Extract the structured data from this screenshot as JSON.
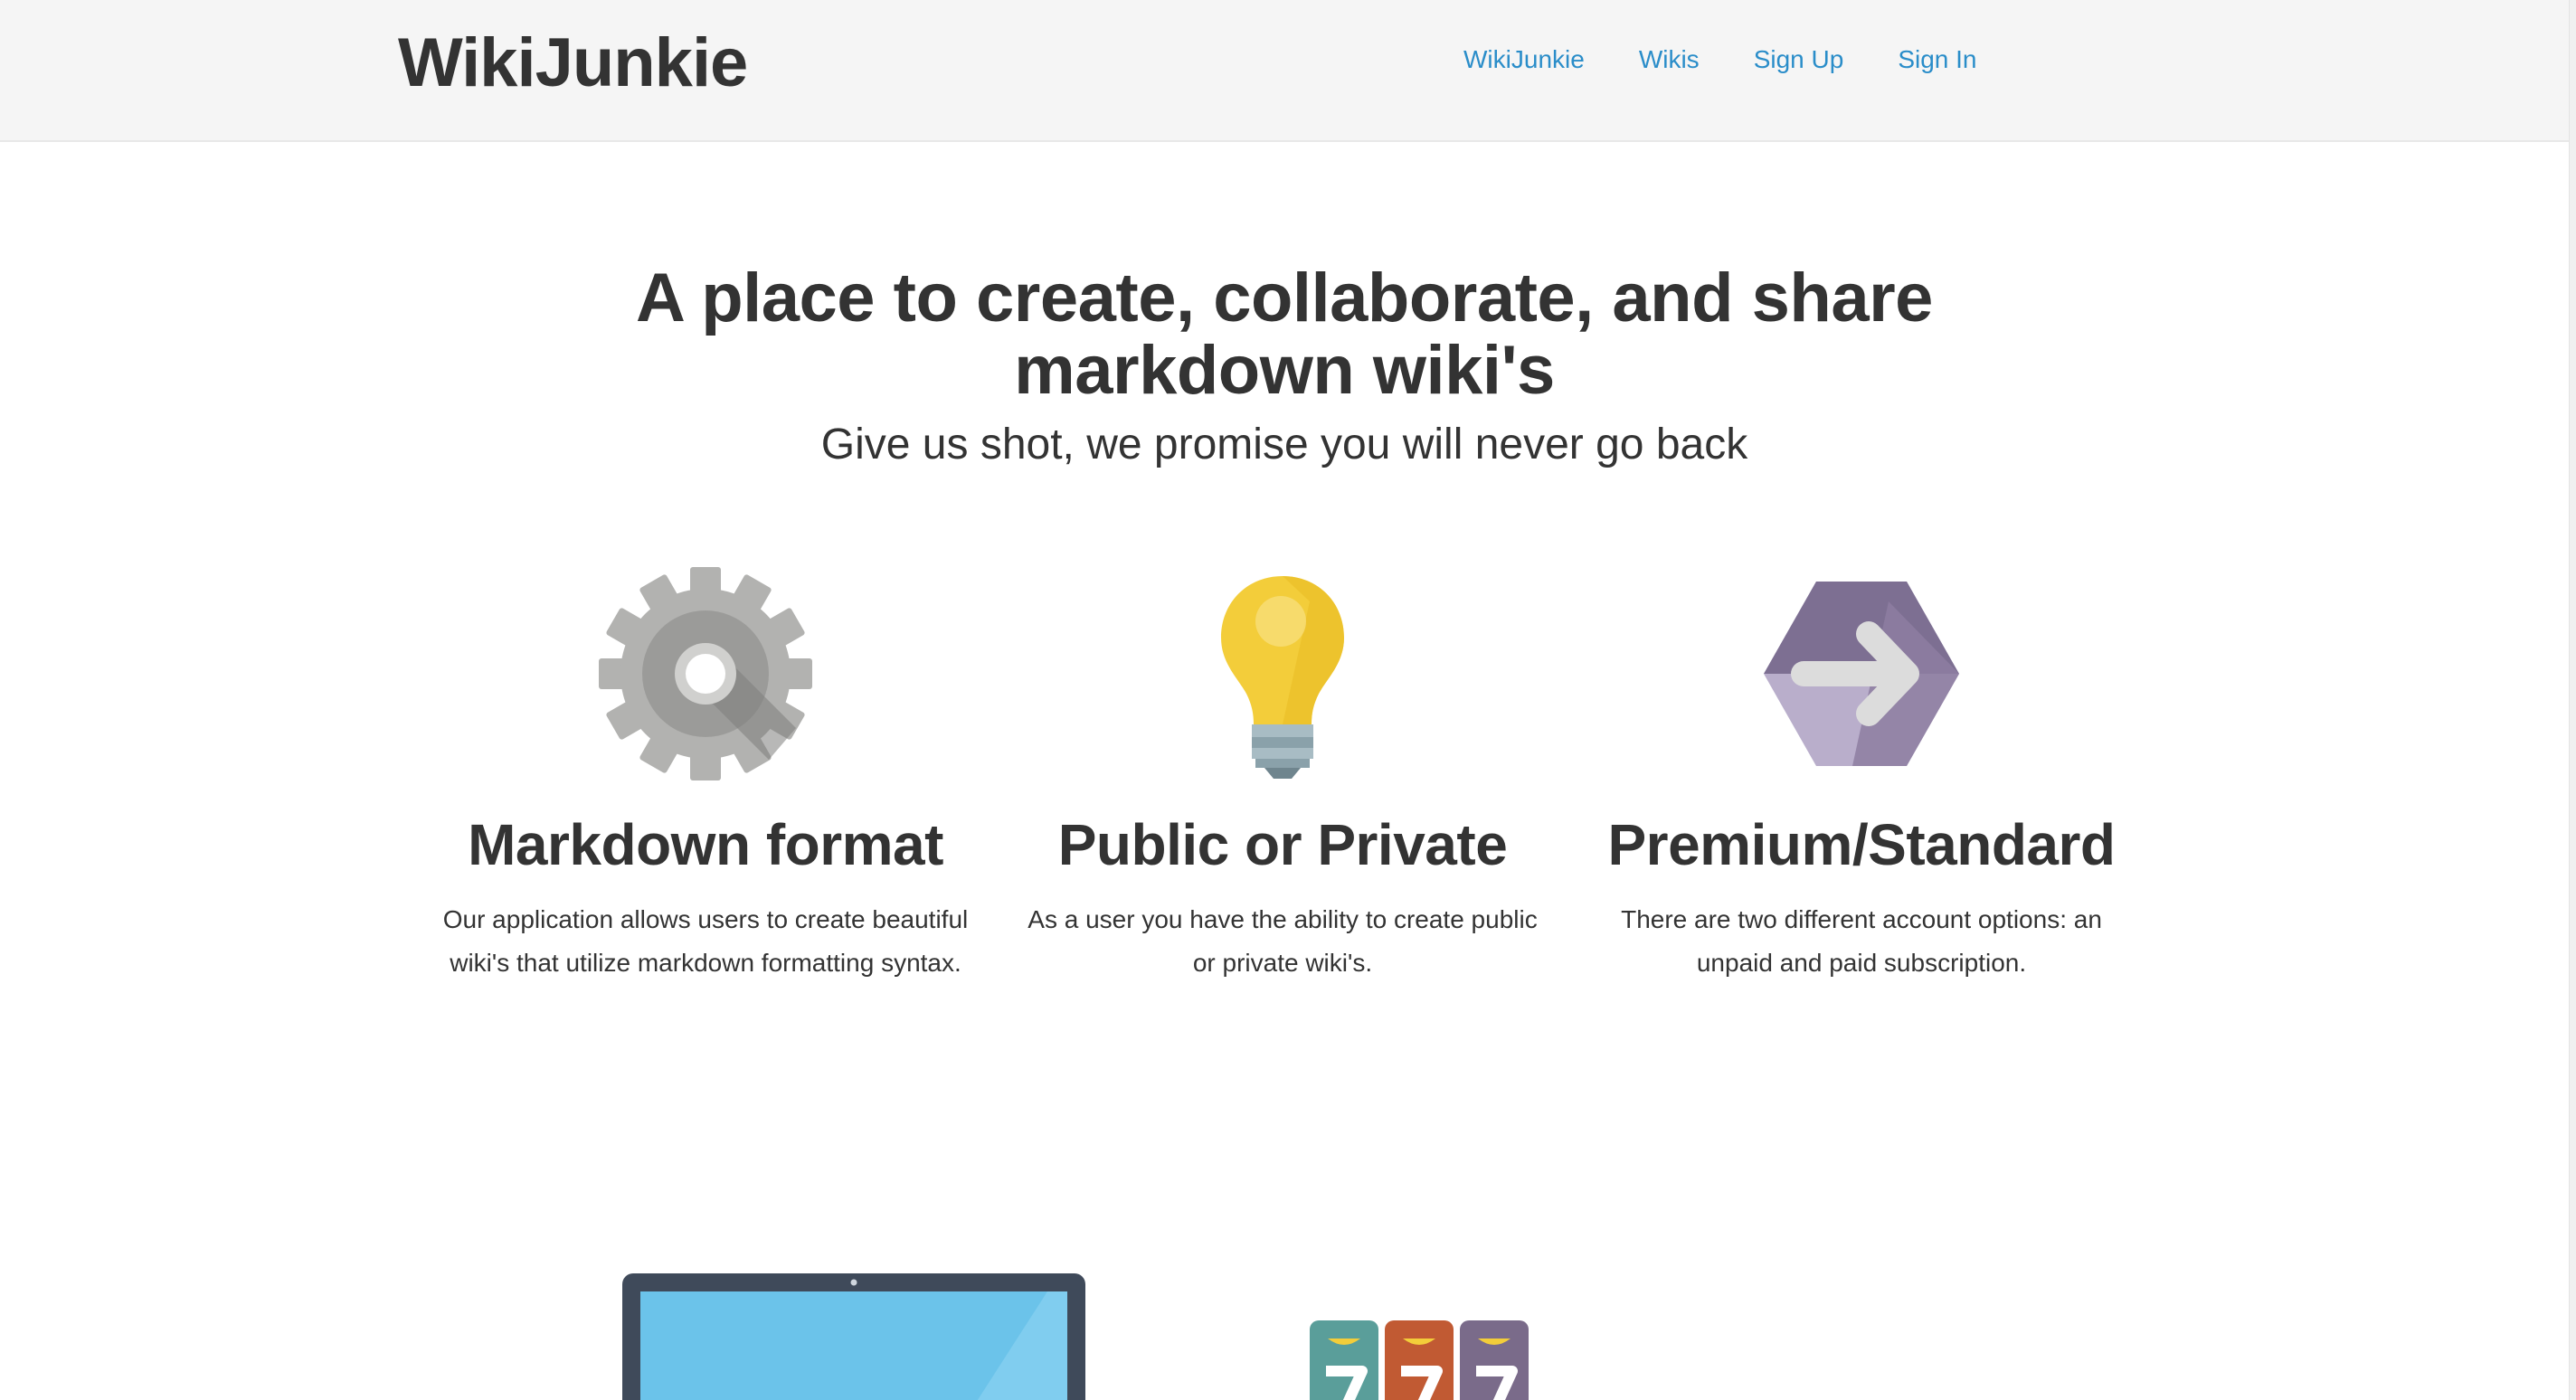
{
  "header": {
    "brand": "WikiJunkie",
    "nav": [
      {
        "label": "WikiJunkie"
      },
      {
        "label": "Wikis"
      },
      {
        "label": "Sign Up"
      },
      {
        "label": "Sign In"
      }
    ]
  },
  "hero": {
    "title_line1": "A place to create, collaborate, and share",
    "title_line2": "markdown wiki's",
    "subtitle": "Give us shot, we promise you will never go back"
  },
  "features": [
    {
      "icon": "gear-icon",
      "title": "Markdown format",
      "line1": "Our application allows users to create beautiful",
      "line2": "wiki's that utilize markdown formatting syntax."
    },
    {
      "icon": "lightbulb-icon",
      "title": "Public or Private",
      "line1": "As a user you have the ability to create public",
      "line2": "or private wiki's."
    },
    {
      "icon": "hexagon-arrow-icon",
      "title": "Premium/Standard",
      "line1": "There are two different account options: an",
      "line2": "unpaid and paid subscription."
    }
  ],
  "illustrations": {
    "laptop": "laptop-icon",
    "slots": "slot-machine-icon"
  },
  "colors": {
    "link": "#2a8dc9",
    "navbar_bg": "#f5f5f5",
    "text": "#333333",
    "gear": "#a8a8a6",
    "bulb": "#f3cd3a",
    "hexagon": "#8d7ea1",
    "screen": "#6bc3ea"
  }
}
